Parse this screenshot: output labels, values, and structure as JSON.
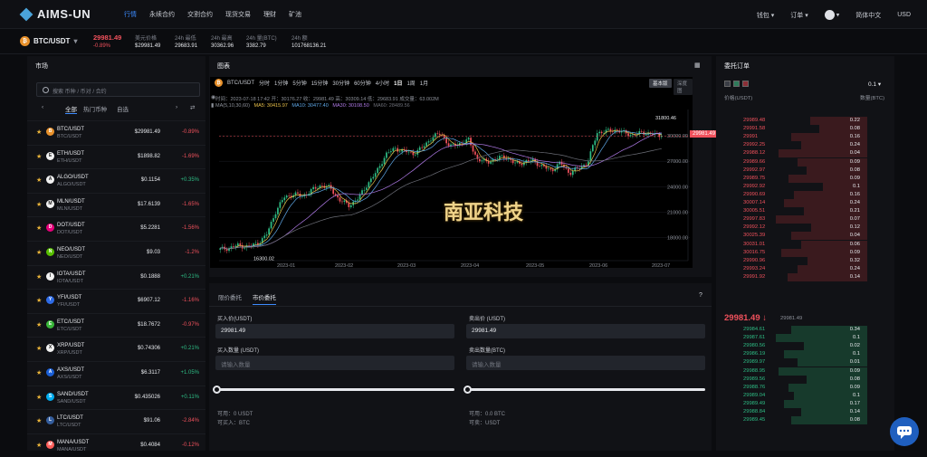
{
  "nav": {
    "logo": "AIMS-UN",
    "links": [
      "行情",
      "永续合约",
      "交割合约",
      "现货交易",
      "理财",
      "矿池"
    ],
    "right": [
      "钱包 ▾",
      "订单 ▾",
      "▾",
      "简体中文",
      "USD"
    ]
  },
  "ticker": {
    "pair": "BTC/USDT",
    "price": "29981.49",
    "change": "-0.89%",
    "stats": [
      {
        "k": "美元价格",
        "v": "$29981.49"
      },
      {
        "k": "24h 最低",
        "v": "29683.91"
      },
      {
        "k": "24h 最高",
        "v": "30362.96"
      },
      {
        "k": "24h 量(BTC)",
        "v": "3382.79"
      },
      {
        "k": "24h 额",
        "v": "101768136.21"
      }
    ]
  },
  "market": {
    "title": "市场",
    "search_placeholder": "搜索 币种 / 币对 / 合约",
    "tabs": [
      "全部",
      "热门币种",
      "自选"
    ],
    "rows": [
      {
        "name": "BTC/USDT",
        "sub": "BTC/USDT",
        "price": "$29981.49",
        "change": "-0.89%",
        "up": false,
        "icon": "B",
        "color": "#e8912b"
      },
      {
        "name": "ETH/USDT",
        "sub": "ETH/USDT",
        "price": "$1898.82",
        "change": "-1.69%",
        "up": false,
        "icon": "E",
        "color": "#f2f2f2"
      },
      {
        "name": "ALGO/USDT",
        "sub": "ALGO/USDT",
        "price": "$0.1154",
        "change": "+0.35%",
        "up": true,
        "icon": "A",
        "color": "#f2f2f2"
      },
      {
        "name": "MLN/USDT",
        "sub": "MLN/USDT",
        "price": "$17.6139",
        "change": "-1.65%",
        "up": false,
        "icon": "M",
        "color": "#f2f2f2"
      },
      {
        "name": "DOT/USDT",
        "sub": "DOT/USDT",
        "price": "$5.2281",
        "change": "-1.56%",
        "up": false,
        "icon": "D",
        "color": "#e6007a"
      },
      {
        "name": "NEO/USDT",
        "sub": "NEO/USDT",
        "price": "$9.03",
        "change": "-1.2%",
        "up": false,
        "icon": "N",
        "color": "#58bf00"
      },
      {
        "name": "IOTA/USDT",
        "sub": "IOTA/USDT",
        "price": "$0.1888",
        "change": "+0.21%",
        "up": true,
        "icon": "I",
        "color": "#f2f2f2"
      },
      {
        "name": "YFI/USDT",
        "sub": "YFI/USDT",
        "price": "$6907.12",
        "change": "-1.16%",
        "up": false,
        "icon": "Y",
        "color": "#2e6be6"
      },
      {
        "name": "ETC/USDT",
        "sub": "ETC/USDT",
        "price": "$18.7672",
        "change": "-0.97%",
        "up": false,
        "icon": "E",
        "color": "#3ab83a"
      },
      {
        "name": "XRP/USDT",
        "sub": "XRP/USDT",
        "price": "$0.74306",
        "change": "+0.21%",
        "up": true,
        "icon": "X",
        "color": "#f2f2f2"
      },
      {
        "name": "AXS/USDT",
        "sub": "AXS/USDT",
        "price": "$6.3117",
        "change": "+1.05%",
        "up": true,
        "icon": "A",
        "color": "#1a5fd6"
      },
      {
        "name": "SAND/USDT",
        "sub": "SAND/USDT",
        "price": "$0.435026",
        "change": "+0.11%",
        "up": true,
        "icon": "S",
        "color": "#00adef"
      },
      {
        "name": "LTC/USDT",
        "sub": "LTC/USDT",
        "price": "$91.06",
        "change": "-2.84%",
        "up": false,
        "icon": "L",
        "color": "#345d9d"
      },
      {
        "name": "MANA/USDT",
        "sub": "MANA/USDT",
        "price": "$0.4084",
        "change": "-0.12%",
        "up": false,
        "icon": "M",
        "color": "#ff5e5b"
      }
    ]
  },
  "chart": {
    "panel_title": "图表",
    "pair": "BTC/USDT",
    "intervals": [
      "分时",
      "1分钟",
      "5分钟",
      "15分钟",
      "30分钟",
      "60分钟",
      "4小时",
      "1日",
      "1周",
      "1月"
    ],
    "active_interval": "1日",
    "version_basic": "基本版",
    "version_depth": "深度图",
    "info1": "时间：2023-07-18 17:42    开：30176.27    收：29981.49    高：30309.14    低：29683.91    成交量：63.002M",
    "ma": [
      "MA(5,10,30,60)",
      "MA5: 30415.97",
      "MA10: 30477.40",
      "MA30: 30108.50",
      "MA60: 28489.56"
    ],
    "price_tag": "29981.49",
    "high_label": "31800.46",
    "low_label": "16300.02",
    "watermark": "南亚科技",
    "chart_data": {
      "type": "candlestick",
      "x_ticks": [
        "2023-01",
        "2023-02",
        "2023-03",
        "2023-04",
        "2023-05",
        "2023-06",
        "2023-07"
      ],
      "y_ticks": [
        "30000.00",
        "27000.00",
        "24000.00",
        "21000.00",
        "18000.00"
      ],
      "ylim": [
        15500,
        33100
      ],
      "close_path": [
        16600,
        16800,
        17100,
        16900,
        17300,
        18200,
        21000,
        22800,
        23100,
        22900,
        23600,
        24200,
        23800,
        22400,
        21800,
        22600,
        24300,
        25700,
        27800,
        28500,
        28200,
        27900,
        28600,
        29800,
        30300,
        28700,
        29100,
        29500,
        27200,
        26900,
        27300,
        27600,
        26700,
        26900,
        27100,
        26400,
        25900,
        26800,
        25600,
        26200,
        26900,
        30400,
        30500,
        30700,
        30300,
        30100,
        30400,
        30200,
        29981
      ],
      "last": 29981.49
    }
  },
  "order": {
    "tabs": [
      "限价委托",
      "市价委托"
    ],
    "buy_price_label": "买入价(USDT)",
    "buy_price": "29981.49",
    "sell_price_label": "卖出价 (USDT)",
    "sell_price": "29981.49",
    "buy_qty_label": "买入数量 (USDT)",
    "buy_qty_placeholder": "请输入数量",
    "sell_qty_label": "卖出数量(BTC)",
    "sell_qty_placeholder": "请输入数量",
    "buy_avail": "可用：0 USDT",
    "buy_can": "可买入：BTC",
    "sell_avail": "可用：0.0 BTC",
    "sell_can": "可卖：USDT"
  },
  "orderbook": {
    "title": "委托订单",
    "precision": "0.1",
    "col_price": "价格(USDT)",
    "col_qty": "数量(BTC)",
    "mid_price": "29981.49",
    "mid_sub": "29981.49",
    "asks": [
      [
        "29989.48",
        "0.22",
        0.45
      ],
      [
        "29991.58",
        "0.08",
        0.38
      ],
      [
        "29991",
        "0.16",
        0.6
      ],
      [
        "29992.25",
        "0.24",
        0.52
      ],
      [
        "29988.12",
        "0.04",
        0.7
      ],
      [
        "29989.66",
        "0.09",
        0.55
      ],
      [
        "29992.97",
        "0.08",
        0.48
      ],
      [
        "29989.75",
        "0.09",
        0.62
      ],
      [
        "29992.92",
        "0.1",
        0.35
      ],
      [
        "29990.69",
        "0.16",
        0.58
      ],
      [
        "30007.14",
        "0.24",
        0.66
      ],
      [
        "30005.51",
        "0.21",
        0.5
      ],
      [
        "29997.83",
        "0.07",
        0.72
      ],
      [
        "29992.12",
        "0.12",
        0.44
      ],
      [
        "30025.39",
        "0.04",
        0.6
      ],
      [
        "30031.01",
        "0.06",
        0.52
      ],
      [
        "30016.75",
        "0.09",
        0.68
      ],
      [
        "29990.96",
        "0.32",
        0.47
      ],
      [
        "29993.24",
        "0.24",
        0.55
      ],
      [
        "29991.92",
        "0.14",
        0.63
      ]
    ],
    "bids": [
      [
        "29984.61",
        "0.34",
        0.6
      ],
      [
        "29987.61",
        "0.1",
        0.72
      ],
      [
        "29980.56",
        "0.02",
        0.5
      ],
      [
        "29986.19",
        "0.1",
        0.66
      ],
      [
        "29989.97",
        "0.01",
        0.55
      ],
      [
        "29988.95",
        "0.09",
        0.7
      ],
      [
        "29989.56",
        "0.08",
        0.48
      ],
      [
        "29988.76",
        "0.09",
        0.62
      ],
      [
        "29989.04",
        "0.1",
        0.58
      ],
      [
        "29989.49",
        "0.17",
        0.66
      ],
      [
        "29988.84",
        "0.14",
        0.52
      ],
      [
        "29989.45",
        "0.08",
        0.6
      ]
    ]
  }
}
